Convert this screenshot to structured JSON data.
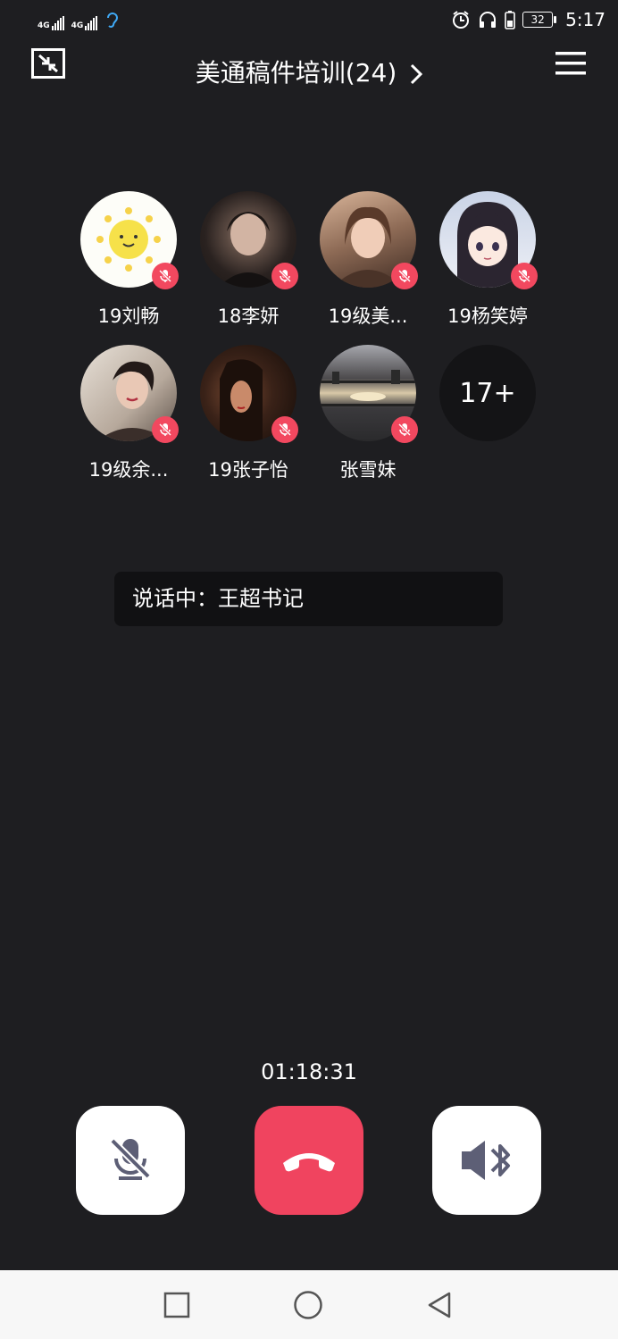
{
  "status_bar": {
    "network_1": "4G",
    "network_2": "4G",
    "battery_level": "32",
    "time": "5:17",
    "icons": [
      "signal-icon",
      "signal-icon",
      "hearing-icon",
      "alarm-icon",
      "headphones-icon",
      "battery-saver-icon",
      "battery-icon"
    ]
  },
  "header": {
    "title": "美通稿件培训(24)",
    "icons": [
      "minimize-icon",
      "chevron-right-icon",
      "menu-icon"
    ]
  },
  "members": [
    {
      "name": "19刘畅",
      "muted": true,
      "avatar": "sun-cartoon"
    },
    {
      "name": "18李妍",
      "muted": true,
      "avatar": "photo-dark"
    },
    {
      "name": "19级美...",
      "muted": true,
      "avatar": "photo-warm"
    },
    {
      "name": "19杨笑婷",
      "muted": true,
      "avatar": "anime-girl"
    },
    {
      "name": "19级余...",
      "muted": true,
      "avatar": "photo-smile"
    },
    {
      "name": "19张子怡",
      "muted": true,
      "avatar": "photo-dim"
    },
    {
      "name": "张雪妹",
      "muted": true,
      "avatar": "photo-sunset"
    }
  ],
  "more_count": "17+",
  "speaking": "说话中：王超书记",
  "timer": "01:18:31",
  "controls": {
    "mic": "mic-off-icon",
    "hangup": "hang-up-icon",
    "speaker": "bluetooth-speaker-icon"
  },
  "navbar": [
    "recent-apps-icon",
    "home-icon",
    "back-icon"
  ],
  "colors": {
    "background": "#1e1e21",
    "accent_red": "#f0445f",
    "mute_badge": "#f2485f"
  }
}
